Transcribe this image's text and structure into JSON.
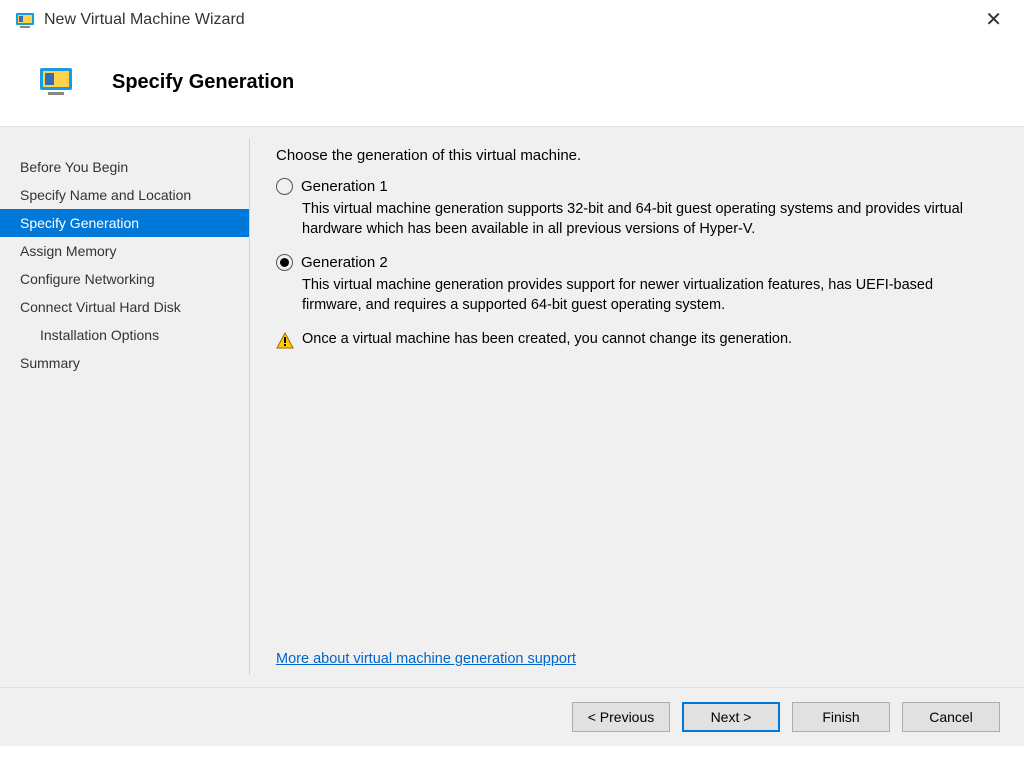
{
  "window": {
    "title": "New Virtual Machine Wizard"
  },
  "header": {
    "heading": "Specify Generation"
  },
  "sidebar": {
    "items": [
      {
        "label": "Before You Begin",
        "selected": false,
        "sub": false
      },
      {
        "label": "Specify Name and Location",
        "selected": false,
        "sub": false
      },
      {
        "label": "Specify Generation",
        "selected": true,
        "sub": false
      },
      {
        "label": "Assign Memory",
        "selected": false,
        "sub": false
      },
      {
        "label": "Configure Networking",
        "selected": false,
        "sub": false
      },
      {
        "label": "Connect Virtual Hard Disk",
        "selected": false,
        "sub": false
      },
      {
        "label": "Installation Options",
        "selected": false,
        "sub": true
      },
      {
        "label": "Summary",
        "selected": false,
        "sub": false
      }
    ]
  },
  "content": {
    "instruction": "Choose the generation of this virtual machine.",
    "options": [
      {
        "label": "Generation 1",
        "checked": false,
        "description": "This virtual machine generation supports 32-bit and 64-bit guest operating systems and provides virtual hardware which has been available in all previous versions of Hyper-V."
      },
      {
        "label": "Generation 2",
        "checked": true,
        "description": "This virtual machine generation provides support for newer virtualization features, has UEFI-based firmware, and requires a supported 64-bit guest operating system."
      }
    ],
    "warning": "Once a virtual machine has been created, you cannot change its generation.",
    "help_link": "More about virtual machine generation support"
  },
  "footer": {
    "previous": "< Previous",
    "next": "Next >",
    "finish": "Finish",
    "cancel": "Cancel"
  }
}
